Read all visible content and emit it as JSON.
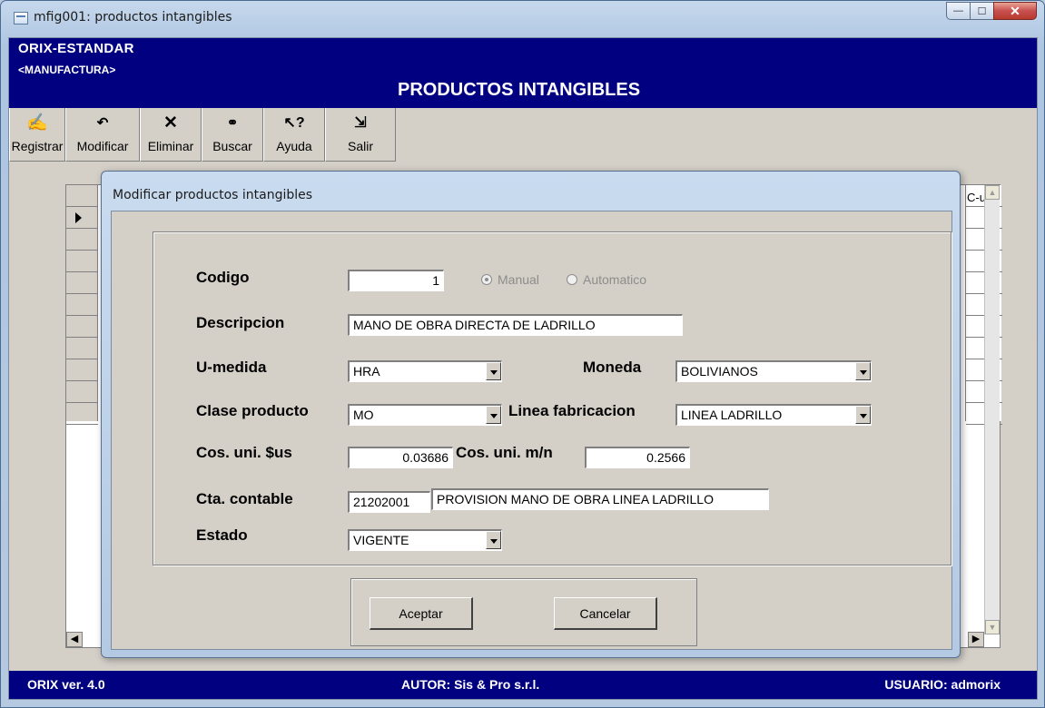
{
  "window": {
    "title": "mfig001: productos intangibles"
  },
  "header": {
    "app_name": "ORIX-ESTANDAR",
    "module": "<MANUFACTURA>",
    "title": "PRODUCTOS INTANGIBLES"
  },
  "toolbar": [
    {
      "label": "Registrar",
      "icon": "register-icon"
    },
    {
      "label": "Modificar",
      "icon": "undo-icon"
    },
    {
      "label": "Eliminar",
      "icon": "delete-x-icon"
    },
    {
      "label": "Buscar",
      "icon": "binoculars-icon"
    },
    {
      "label": "Ayuda",
      "icon": "help-arrow-icon"
    },
    {
      "label": "Salir",
      "icon": "exit-door-icon"
    }
  ],
  "grid": {
    "visible_header": "C-u"
  },
  "dialog": {
    "title": "Modificar productos intangibles",
    "codigo_label": "Codigo",
    "codigo_value": "1",
    "radio_manual": "Manual",
    "radio_auto": "Automatico",
    "descripcion_label": "Descripcion",
    "descripcion_value": "MANO DE OBRA DIRECTA DE LADRILLO",
    "umedida_label": "U-medida",
    "umedida_value": "HRA",
    "moneda_label": "Moneda",
    "moneda_value": "BOLIVIANOS",
    "clase_label": "Clase producto",
    "clase_value": "MO",
    "linea_label": "Linea fabricacion",
    "linea_value": "LINEA LADRILLO",
    "cos_us_label": "Cos. uni. $us",
    "cos_us_value": "0.03686",
    "cos_mn_label": "Cos. uni. m/n",
    "cos_mn_value": "0.2566",
    "cta_label": "Cta. contable",
    "cta_code": "21202001",
    "cta_desc": "PROVISION MANO DE OBRA LINEA LADRILLO",
    "estado_label": "Estado",
    "estado_value": "VIGENTE",
    "accept": "Aceptar",
    "cancel": "Cancelar"
  },
  "status": {
    "version": "ORIX ver. 4.0",
    "author": "AUTOR: Sis & Pro s.r.l.",
    "user": "USUARIO: admorix"
  }
}
